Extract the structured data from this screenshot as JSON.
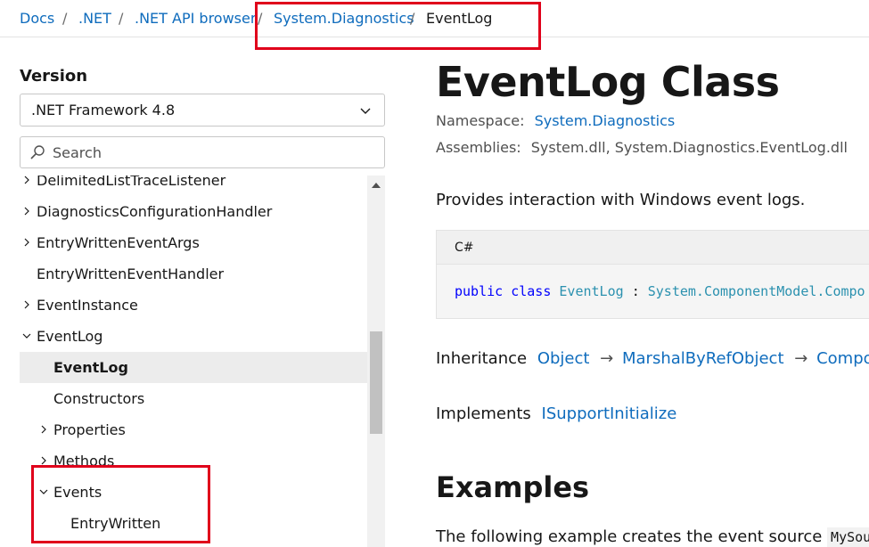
{
  "breadcrumb": {
    "items": [
      {
        "label": "Docs"
      },
      {
        "label": ".NET"
      },
      {
        "label": ".NET API browser"
      },
      {
        "label": "System.Diagnostics"
      },
      {
        "label": "EventLog"
      }
    ],
    "separator": "/"
  },
  "sidebar": {
    "version_label": "Version",
    "version_value": ".NET Framework 4.8",
    "search_placeholder": "Search",
    "tree": [
      {
        "label": "DelimitedListTraceListener",
        "expandable": true
      },
      {
        "label": "DiagnosticsConfigurationHandler",
        "expandable": true
      },
      {
        "label": "EntryWrittenEventArgs",
        "expandable": true
      },
      {
        "label": "EntryWrittenEventHandler",
        "expandable": false
      },
      {
        "label": "EventInstance",
        "expandable": true
      },
      {
        "label": "EventLog",
        "expandable": true,
        "expanded": true
      },
      {
        "label": "EventLog",
        "selected": true
      },
      {
        "label": "Constructors"
      },
      {
        "label": "Properties",
        "expandable": true
      },
      {
        "label": "Methods",
        "expandable": true
      },
      {
        "label": "Events",
        "expandable": true,
        "expanded": true
      },
      {
        "label": "EntryWritten"
      }
    ]
  },
  "main": {
    "title": "EventLog Class",
    "namespace_label": "Namespace:",
    "namespace_value": "System.Diagnostics",
    "assemblies_label": "Assemblies:",
    "assemblies_value": "System.dll, System.Diagnostics.EventLog.dll",
    "summary": "Provides interaction with Windows event logs.",
    "code": {
      "language": "C#",
      "kw1": "public",
      "kw2": "class",
      "class_name": "EventLog",
      "colon": ":",
      "base": "System.ComponentModel.Compo"
    },
    "inheritance_label": "Inheritance",
    "inheritance": [
      "Object",
      "MarshalByRefObject",
      "Componen"
    ],
    "arrow": "→",
    "implements_label": "Implements",
    "implements_value": "ISupportInitialize",
    "examples_title": "Examples",
    "examples_text": "The following example creates the event source",
    "examples_code": "MySource"
  },
  "colors": {
    "link": "#0f6cbd",
    "highlight": "#e0001b",
    "keyword": "#0101fd",
    "type": "#2b91af"
  }
}
